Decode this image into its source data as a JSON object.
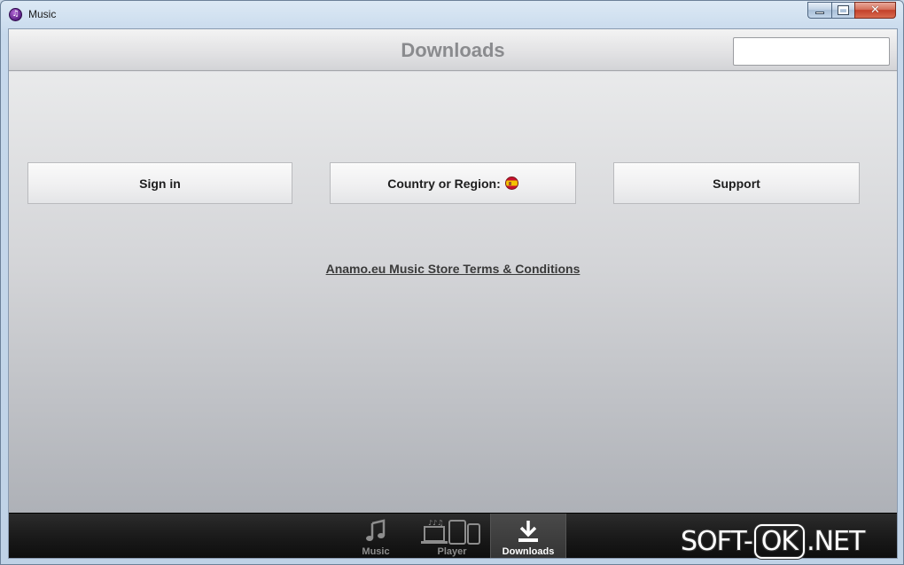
{
  "window": {
    "title": "Music"
  },
  "header": {
    "title": "Downloads",
    "search_value": "",
    "search_placeholder": ""
  },
  "buttons": {
    "sign_in": "Sign in",
    "country": "Country or Region:",
    "country_flag": "spain-flag-icon",
    "support": "Support"
  },
  "links": {
    "terms": "Anamo.eu Music Store Terms & Conditions "
  },
  "tabs": [
    {
      "label": "Music",
      "icon": "music-note-icon",
      "active": false
    },
    {
      "label": "Player",
      "icon": "devices-icon",
      "active": false
    },
    {
      "label": "Downloads",
      "icon": "download-icon",
      "active": true
    }
  ],
  "watermark": {
    "left": "SOFT-",
    "box": "OK",
    "right": ".NET"
  },
  "colors": {
    "tabbar": "#1a1a1a",
    "active_tab_text": "#ffffff",
    "header_title": "#8a8b8e",
    "close_button": "#c4402a"
  }
}
